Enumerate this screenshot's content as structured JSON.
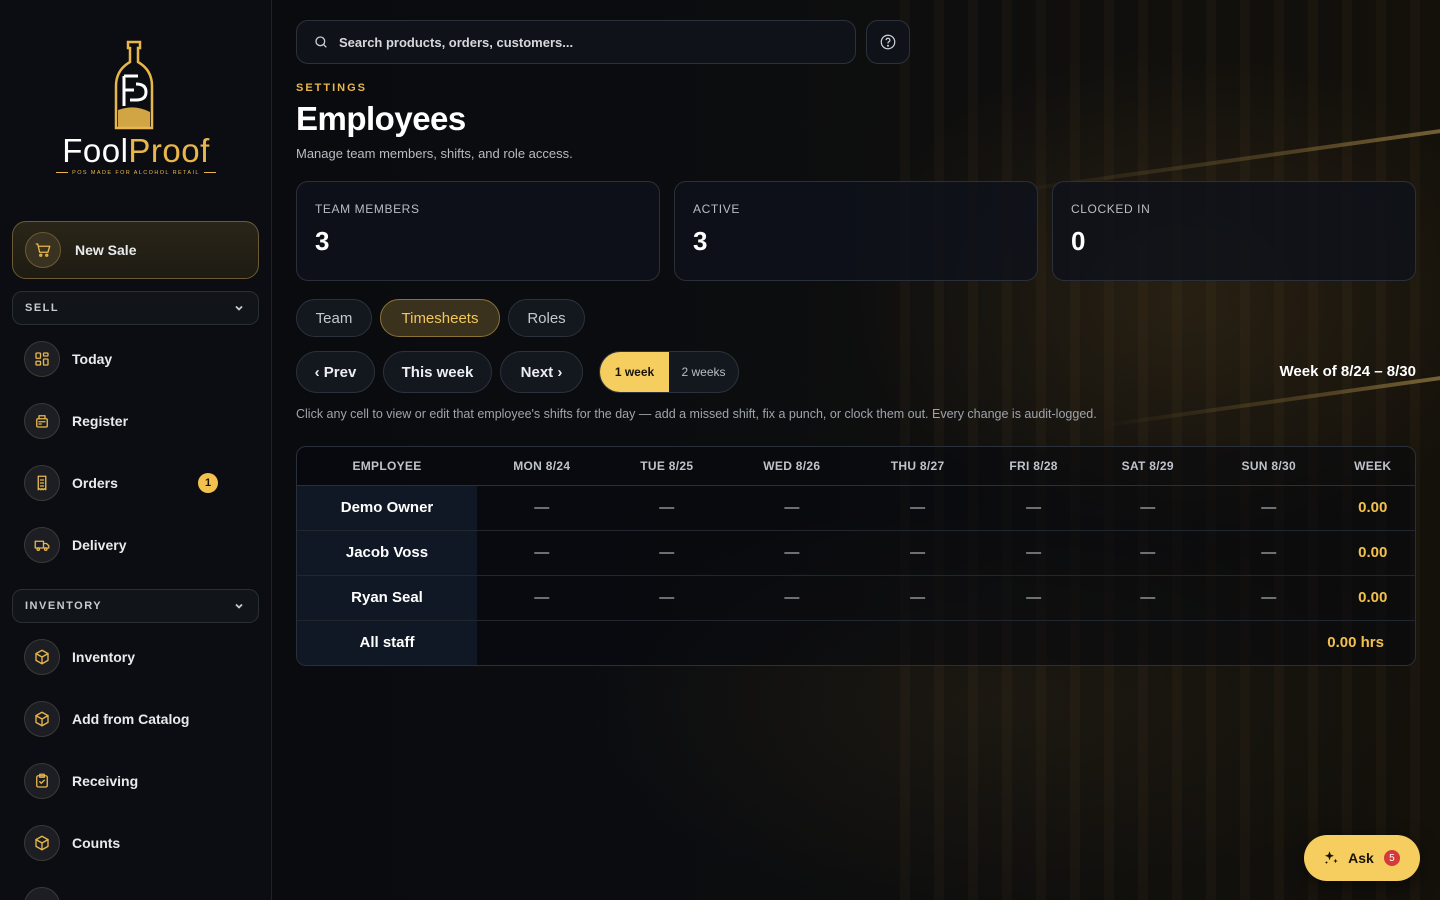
{
  "brand": {
    "name_part1": "Fool",
    "name_part2": "Proof",
    "tagline": "POS MADE FOR ALCOHOL RETAIL",
    "accent_color": "#e8b64a"
  },
  "sidebar": {
    "new_sale": "New Sale",
    "sections": [
      {
        "title": "SELL",
        "items": [
          {
            "label": "Today",
            "icon": "dashboard-icon"
          },
          {
            "label": "Register",
            "icon": "register-icon"
          },
          {
            "label": "Orders",
            "icon": "receipt-icon",
            "badge": "1"
          },
          {
            "label": "Delivery",
            "icon": "truck-icon"
          }
        ]
      },
      {
        "title": "INVENTORY",
        "items": [
          {
            "label": "Inventory",
            "icon": "box-icon"
          },
          {
            "label": "Add from Catalog",
            "icon": "box-icon"
          },
          {
            "label": "Receiving",
            "icon": "clipboard-check-icon"
          },
          {
            "label": "Counts",
            "icon": "box-icon"
          }
        ]
      }
    ]
  },
  "search": {
    "placeholder": "Search products, orders, customers..."
  },
  "header": {
    "eyebrow": "SETTINGS",
    "title": "Employees",
    "subtitle": "Manage team members, shifts, and role access."
  },
  "stats": [
    {
      "label": "TEAM MEMBERS",
      "value": "3"
    },
    {
      "label": "ACTIVE",
      "value": "3"
    },
    {
      "label": "CLOCKED IN",
      "value": "0"
    }
  ],
  "tabs": [
    {
      "label": "Team",
      "active": false
    },
    {
      "label": "Timesheets",
      "active": true
    },
    {
      "label": "Roles",
      "active": false
    }
  ],
  "week_nav": {
    "prev": "‹ Prev",
    "this_week": "This week",
    "next": "Next ›",
    "range_options": [
      "1 week",
      "2 weeks"
    ],
    "range_selected": "1 week",
    "week_label": "Week of 8/24 – 8/30"
  },
  "hint": "Click any cell to view or edit that employee's shifts for the day — add a missed shift, fix a punch, or clock them out. Every change is audit-logged.",
  "timesheet": {
    "columns": [
      "EMPLOYEE",
      "MON 8/24",
      "TUE 8/25",
      "WED 8/26",
      "THU 8/27",
      "FRI 8/28",
      "SAT 8/29",
      "SUN 8/30",
      "WEEK"
    ],
    "rows": [
      {
        "name": "Demo Owner",
        "days": [
          "—",
          "—",
          "—",
          "—",
          "—",
          "—",
          "—"
        ],
        "week": "0.00"
      },
      {
        "name": "Jacob Voss",
        "days": [
          "—",
          "—",
          "—",
          "—",
          "—",
          "—",
          "—"
        ],
        "week": "0.00"
      },
      {
        "name": "Ryan Seal",
        "days": [
          "—",
          "—",
          "—",
          "—",
          "—",
          "—",
          "—"
        ],
        "week": "0.00"
      }
    ],
    "total_label": "All staff",
    "total_value": "0.00 hrs"
  },
  "ask": {
    "label": "Ask",
    "badge": "5"
  }
}
